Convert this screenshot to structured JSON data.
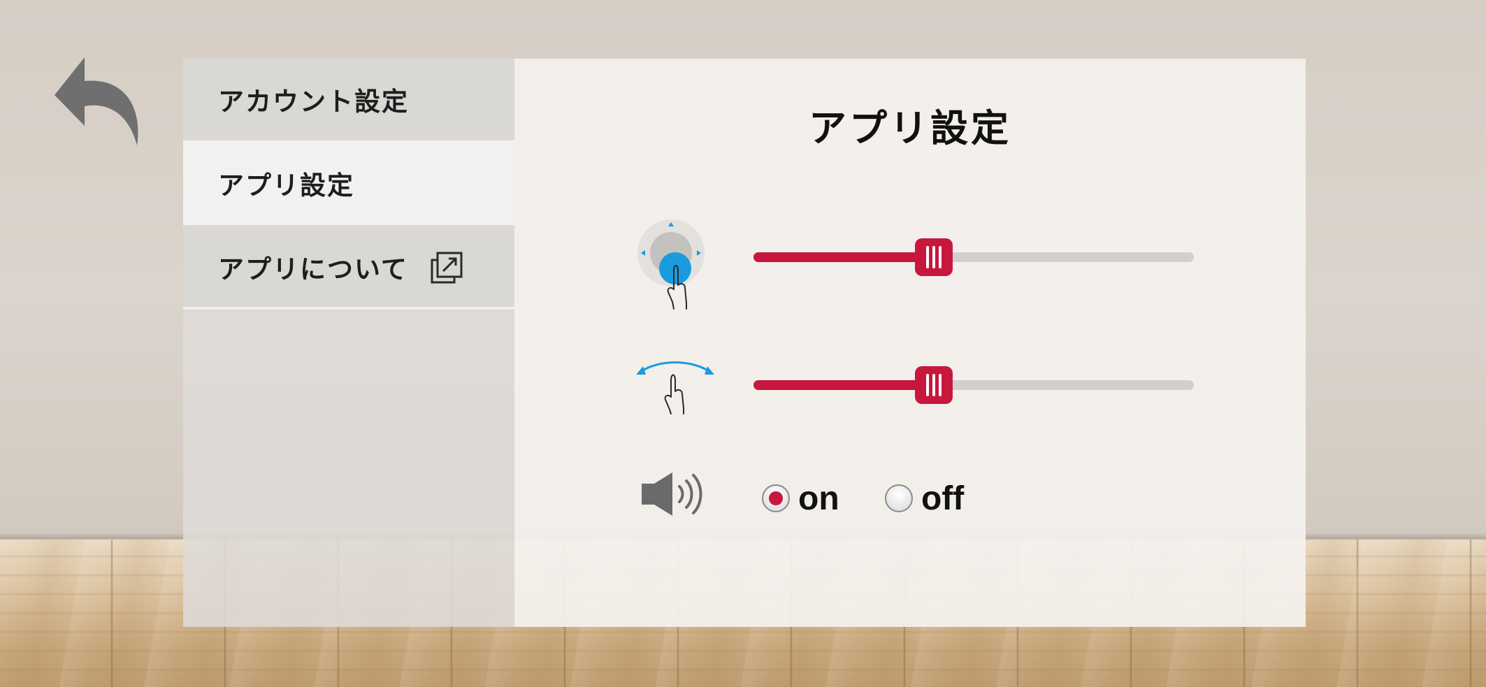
{
  "sidebar": {
    "items": [
      {
        "label": "アカウント設定",
        "selected": false
      },
      {
        "label": "アプリ設定",
        "selected": true
      },
      {
        "label": "アプリについて",
        "selected": false,
        "icon": "external-link-icon"
      }
    ]
  },
  "main": {
    "title": "アプリ設定",
    "settings": [
      {
        "icon": "joystick-touch-icon",
        "type": "slider",
        "value_percent": 41
      },
      {
        "icon": "swipe-gesture-icon",
        "type": "slider",
        "value_percent": 41
      },
      {
        "icon": "speaker-icon",
        "type": "radio",
        "options": [
          {
            "label": "on",
            "checked": true
          },
          {
            "label": "off",
            "checked": false
          }
        ]
      }
    ]
  },
  "colors": {
    "accent": "#c8173d",
    "track": "#d2d0cd",
    "icon_blue": "#1a9be0",
    "back_arrow": "#6f6f6f"
  }
}
